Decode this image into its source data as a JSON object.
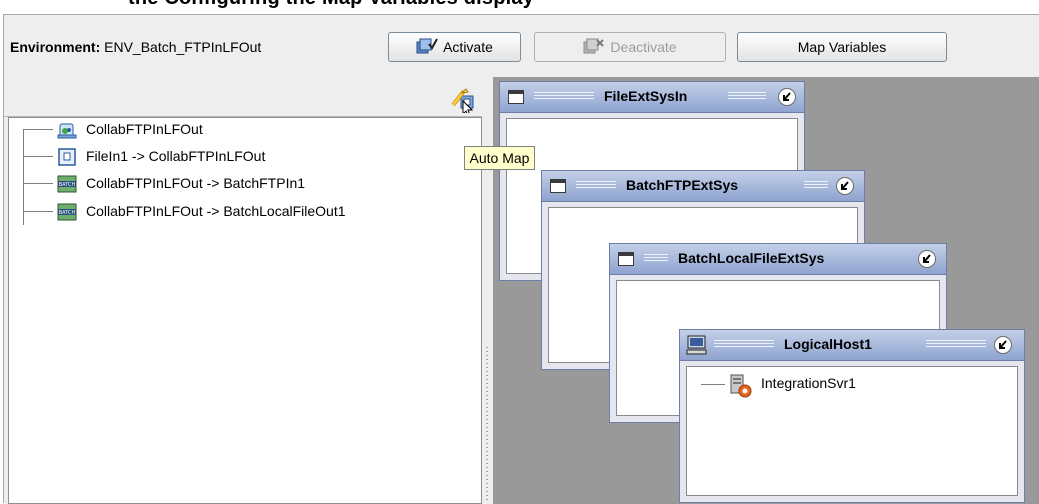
{
  "caption": "the Configuring the Map Variables display",
  "toolbar": {
    "environment_label": "Environment:",
    "environment_name": "ENV_Batch_FTPInLFOut",
    "activate_label": "Activate",
    "deactivate_label": "Deactivate",
    "map_variables_label": "Map Variables"
  },
  "left_panel": {
    "tooltip": "Auto Map",
    "tree": [
      {
        "label": "CollabFTPInLFOut",
        "icon": "collaboration-icon"
      },
      {
        "label": "FileIn1 -> CollabFTPInLFOut",
        "icon": "file-connection-icon"
      },
      {
        "label": "CollabFTPInLFOut -> BatchFTPIn1",
        "icon": "batch-connection-icon"
      },
      {
        "label": "CollabFTPInLFOut -> BatchLocalFileOut1",
        "icon": "batch-connection-icon"
      }
    ]
  },
  "canvas": {
    "windows": [
      {
        "title": "FileExtSysIn"
      },
      {
        "title": "BatchFTPExtSys"
      },
      {
        "title": "BatchLocalFileExtSys"
      },
      {
        "title": "LogicalHost1",
        "items": [
          {
            "label": "IntegrationSvr1",
            "icon": "integration-server-icon"
          }
        ]
      }
    ]
  },
  "colors": {
    "canvas_bg": "#999999",
    "titlebar": "#8ea3cf",
    "tooltip_bg": "#ffffcc"
  }
}
